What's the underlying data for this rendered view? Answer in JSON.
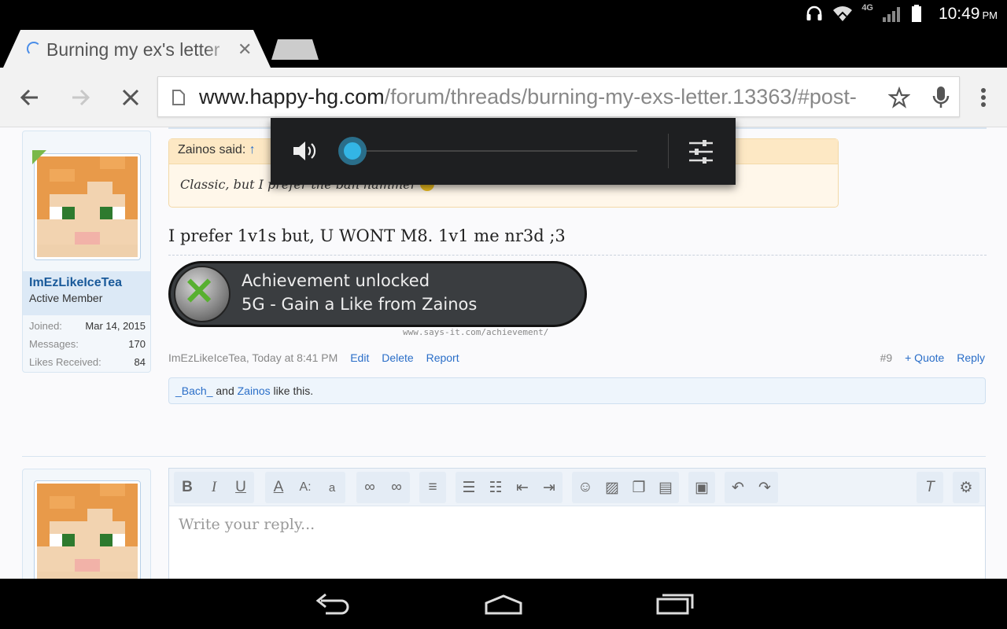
{
  "status_bar": {
    "network": "4G",
    "time": "10:49",
    "ampm": "PM"
  },
  "tab": {
    "title": "Burning my ex's letter",
    "close_glyph": "✕"
  },
  "address": {
    "host": "www.happy-hg.com",
    "path": "/forum/threads/burning-my-exs-letter.13363/#post-"
  },
  "post": {
    "user": {
      "name": "ImEzLikeIceTea",
      "title": "Active Member"
    },
    "stats": [
      {
        "label": "Joined:",
        "value": "Mar 14, 2015"
      },
      {
        "label": "Messages:",
        "value": "170"
      },
      {
        "label": "Likes Received:",
        "value": "84"
      }
    ],
    "quote": {
      "author": "Zainos said:",
      "arrow": "↑",
      "text": "Classic, but I prefer the ban hammer"
    },
    "message": "I prefer 1v1s but, U WONT M8. 1v1 me nr3d ;3",
    "achievement": {
      "line1": "Achievement unlocked",
      "line2": "5G - Gain a Like from Zainos",
      "source": "www.says-it.com/achievement/"
    },
    "meta": {
      "author_time": "ImEzLikeIceTea, Today at 8:41 PM",
      "edit": "Edit",
      "delete": "Delete",
      "report": "Report",
      "number": "#9",
      "quote": "+ Quote",
      "reply": "Reply"
    },
    "likes": {
      "user1": "_Bach_",
      "and": " and ",
      "user2": "Zainos",
      "suffix": " like this."
    }
  },
  "editor": {
    "placeholder": "Write your reply..."
  },
  "volume": {
    "level": 0
  },
  "colors": {
    "link": "#2a6ec8",
    "volume_accent": "#33b5e5"
  }
}
